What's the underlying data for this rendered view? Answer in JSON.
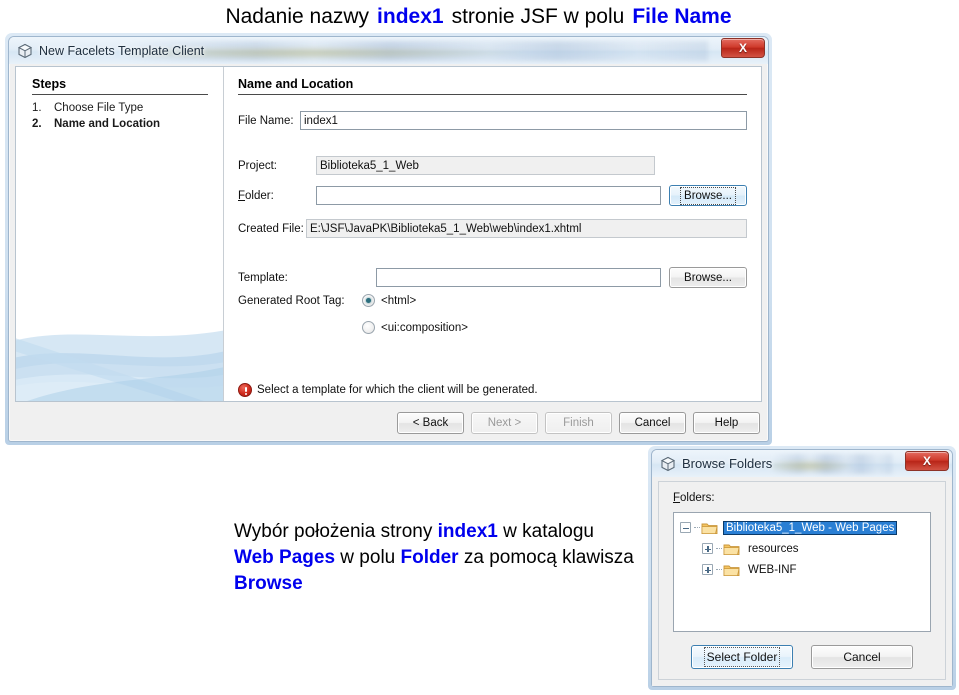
{
  "slide": {
    "title_parts": [
      {
        "text": "Nadanie nazwy",
        "bold": false
      },
      {
        "text": "index1",
        "bold": true
      },
      {
        "text": "stronie JSF w polu",
        "bold": false
      },
      {
        "text": "File Name",
        "bold": true
      }
    ],
    "title_plain": "Nadanie nazwy index1 stronie JSF w polu File Name",
    "caption_parts": [
      {
        "text": "Wybór położenia strony ",
        "bold": false
      },
      {
        "text": "index1",
        "bold": true
      },
      {
        "text": " w katalogu ",
        "bold": false
      },
      {
        "text": "Web Pages",
        "bold": true
      },
      {
        "text": " w polu ",
        "bold": false
      },
      {
        "text": "Folder",
        "bold": true
      },
      {
        "text": " za pomocą klawisza ",
        "bold": false
      },
      {
        "text": "Browse",
        "bold": true
      }
    ],
    "accent_color": "#0000ee"
  },
  "wizard": {
    "title": "New Facelets Template Client",
    "title_icon": "cube-icon",
    "close_label": "X",
    "steps": {
      "heading": "Steps",
      "items": [
        {
          "number": "1.",
          "label": "Choose File Type",
          "active": false
        },
        {
          "number": "2.",
          "label": "Name and Location",
          "active": true
        }
      ]
    },
    "panel": {
      "heading": "Name and Location",
      "file_name_label": "File Name:",
      "file_name_value": "index1",
      "project_label": "Project:",
      "project_value": "Biblioteka5_1_Web",
      "folder_label": "Folder:",
      "folder_value": "",
      "folder_browse_label": "Browse...",
      "created_file_label": "Created File:",
      "created_file_value": "E:\\JSF\\JavaPK\\Biblioteka5_1_Web\\web\\index1.xhtml",
      "template_label": "Template:",
      "template_value": "",
      "template_browse_label": "Browse...",
      "root_tag_label": "Generated Root Tag:",
      "root_tag_options": [
        {
          "label": "<html>",
          "selected": true
        },
        {
          "label": "<ui:composition>",
          "selected": false
        }
      ],
      "error_icon": "error-icon",
      "error_message": "Select a template for which the client will be generated."
    },
    "footer_buttons": [
      {
        "label": "< Back",
        "disabled": false
      },
      {
        "label": "Next >",
        "disabled": true
      },
      {
        "label": "Finish",
        "disabled": true
      },
      {
        "label": "Cancel",
        "disabled": false
      },
      {
        "label": "Help",
        "disabled": false
      }
    ]
  },
  "browse_dialog": {
    "title": "Browse Folders",
    "title_icon": "cube-icon",
    "close_label": "X",
    "folders_label": "Folders:",
    "tree": [
      {
        "label": "Biblioteka5_1_Web - Web Pages",
        "level": 1,
        "expander": "minus",
        "selected": true
      },
      {
        "label": "resources",
        "level": 2,
        "expander": "plus",
        "selected": false
      },
      {
        "label": "WEB-INF",
        "level": 2,
        "expander": "plus",
        "selected": false
      }
    ],
    "buttons": [
      {
        "label": "Select Folder",
        "primary": true
      },
      {
        "label": "Cancel",
        "primary": false
      }
    ],
    "selection_color": "#2a7fd4"
  }
}
